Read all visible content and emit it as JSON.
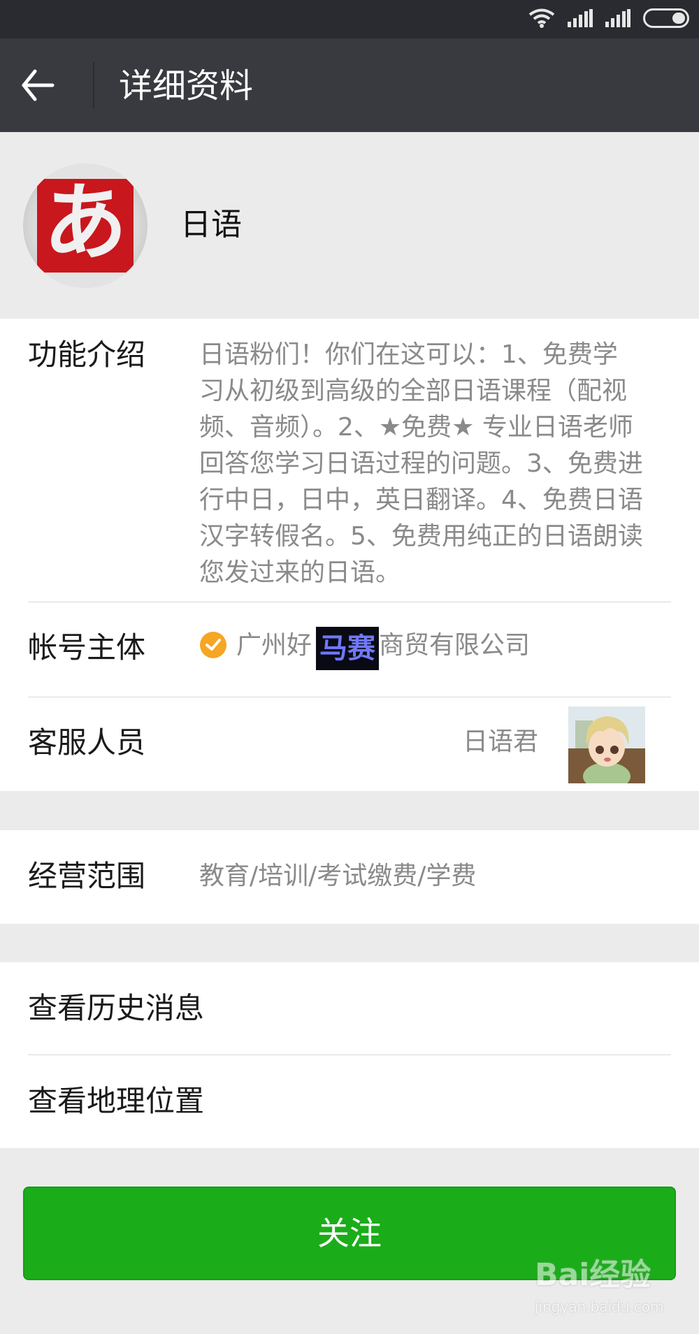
{
  "header": {
    "title": "详细资料"
  },
  "profile": {
    "name": "日语",
    "avatar_glyph": "あ"
  },
  "info": {
    "intro_label": "功能介绍",
    "intro_lines": [
      "日语粉们！你们在这可以：1、免费学",
      "习从初级到高级的全部日语课程（配视",
      "频、音频）。2、★免费★ 专业日语老师",
      "回答您学习日语过程的问题。3、免费进",
      "行中日，日中，英日翻译。4、免费日语",
      "汉字转假名。5、免费用纯正的日语朗读",
      "您发过来的日语。"
    ],
    "account_label": "帐号主体",
    "account_prefix": "广州好",
    "account_redacted": "马赛克",
    "account_suffix": "商贸有限公司",
    "staff_label": "客服人员",
    "staff_name": "日语君"
  },
  "business": {
    "label": "经营范围",
    "value": "教育/培训/考试缴费/学费"
  },
  "actions": {
    "history": "查看历史消息",
    "location": "查看地理位置"
  },
  "follow_button": "关注",
  "watermark": {
    "brand": "Bai经验",
    "url": "jingyan.baidu.com"
  },
  "icons": [
    "back-arrow-icon",
    "wifi-icon",
    "signal-icon",
    "battery-icon",
    "verified-check-icon"
  ],
  "colors": {
    "header": "#393a3f",
    "accent_green": "#1aad19",
    "verify_orange": "#f5a623"
  }
}
